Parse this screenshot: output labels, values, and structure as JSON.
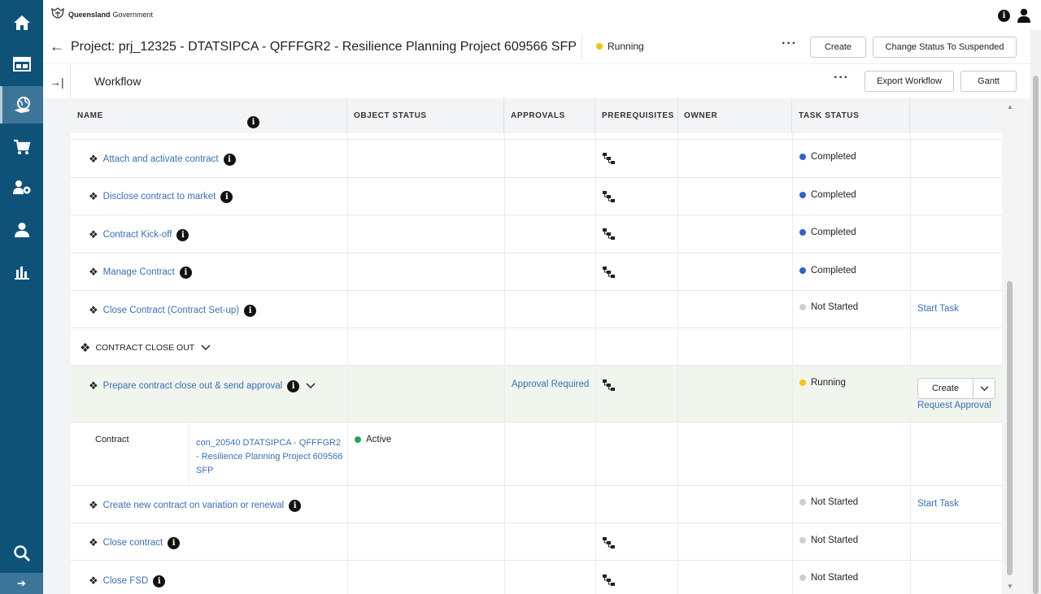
{
  "sidebar": {
    "items": [
      {
        "icon": "home-icon",
        "label": "Home"
      },
      {
        "icon": "dashboard-icon",
        "label": "Dashboard"
      },
      {
        "icon": "globe-hand-icon",
        "label": "Projects",
        "active": true
      },
      {
        "icon": "cart-icon",
        "label": "Cart"
      },
      {
        "icon": "people-gear-icon",
        "label": "Suppliers"
      },
      {
        "icon": "person-icon",
        "label": "Profile"
      },
      {
        "icon": "bar-chart-icon",
        "label": "Reports"
      }
    ],
    "search_icon": "search-icon",
    "expand_icon": "arrow-right-icon"
  },
  "topbar": {
    "logo_bold": "Queensland",
    "logo_rest": "Government"
  },
  "header": {
    "title": "Project: prj_12325 - DTATSIPCA - QFFFGR2 - Resilience Planning Project 609566 SFP",
    "status": "Running",
    "status_color": "#f0c419",
    "create_label": "Create",
    "change_status_label": "Change Status To Suspended"
  },
  "workflow": {
    "title": "Workflow",
    "export_label": "Export Workflow",
    "gantt_label": "Gantt"
  },
  "table": {
    "columns": [
      "NAME",
      "OBJECT STATUS",
      "APPROVALS",
      "PREREQUISITES",
      "OWNER",
      "TASK STATUS"
    ],
    "rows": [
      {
        "name": "Attach and activate contract",
        "status": "Completed"
      },
      {
        "name": "Disclose contract to market",
        "status": "Completed"
      },
      {
        "name": "Contract Kick-off",
        "status": "Completed"
      },
      {
        "name": "Manage Contract",
        "status": "Completed"
      },
      {
        "name": "Close Contract (Contract Set-up)",
        "status": "Not Started",
        "action": "Start Task"
      },
      {
        "name": "CONTRACT CLOSE OUT"
      },
      {
        "name": "Prepare contract close out & send approval",
        "approval": "Approval Required",
        "status": "Running",
        "create": "Create",
        "request": "Request Approval"
      },
      {
        "label": "Contract",
        "contract": "con_20540 DTATSIPCA - QFFFGR2 - Resilience Planning Project 609566 SFP",
        "object_status": "Active"
      },
      {
        "name": "Create new contract on variation or renewal",
        "status": "Not Started",
        "action": "Start Task"
      },
      {
        "name": "Close contract",
        "status": "Not Started"
      },
      {
        "name": "Close FSD",
        "status": "Not Started"
      }
    ]
  },
  "colors": {
    "completed": "#3560c9",
    "not_started": "#cfcfcf",
    "running": "#f0c419",
    "active": "#27a25a",
    "sidebar": "#0e5278"
  }
}
